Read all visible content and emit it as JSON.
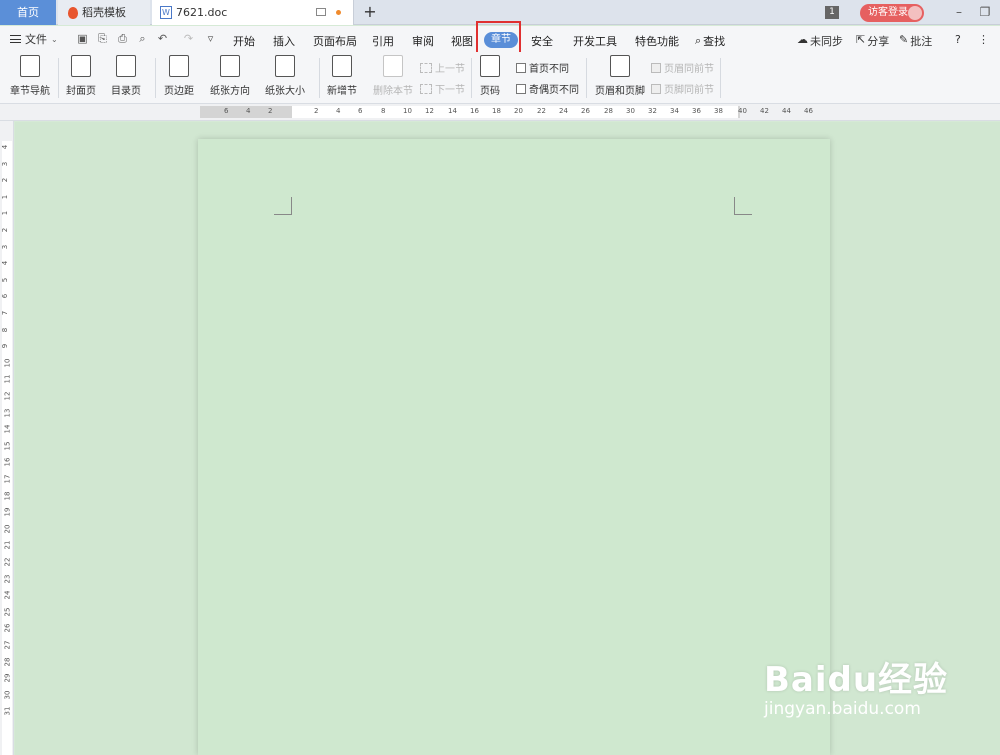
{
  "tabs": {
    "home": "首页",
    "template": "稻壳模板",
    "doc": "7621.doc",
    "doc_icon": "W",
    "new_tab": "+"
  },
  "titlebar": {
    "count": "1",
    "login": "访客登录"
  },
  "menu": {
    "file": "文件",
    "items": [
      "开始",
      "插入",
      "页面布局",
      "引用",
      "审阅",
      "视图"
    ],
    "active": "章节",
    "items_after": [
      "安全",
      "开发工具",
      "特色功能"
    ],
    "search": "查找",
    "sync": "未同步",
    "share": "分享",
    "comment": "批注",
    "help": "?"
  },
  "ribbon": {
    "section_nav": "章节导航",
    "cover": "封面页",
    "toc": "目录页",
    "margin": "页边距",
    "orientation": "纸张方向",
    "size": "纸张大小",
    "new_section": "新增节",
    "delete_section": "删除本节",
    "prev_section": "上一节",
    "next_section": "下一节",
    "page_num": "页码",
    "first_diff": "首页不同",
    "oddeven_diff": "奇偶页不同",
    "header_footer": "页眉和页脚",
    "header_same": "页眉同前节",
    "footer_same": "页脚同前节"
  },
  "ruler": {
    "h_labels": [
      "6",
      "4",
      "2",
      "2",
      "4",
      "6",
      "8",
      "10",
      "12",
      "14",
      "16",
      "18",
      "20",
      "22",
      "24",
      "26",
      "28",
      "30",
      "32",
      "34",
      "36",
      "38",
      "40",
      "42",
      "44",
      "46"
    ],
    "v_labels": [
      "4",
      "3",
      "2",
      "1",
      "1",
      "2",
      "3",
      "4",
      "5",
      "6",
      "7",
      "8",
      "9",
      "10",
      "11",
      "12",
      "13",
      "14",
      "15",
      "16",
      "17",
      "18",
      "19",
      "20",
      "21",
      "22",
      "23",
      "24",
      "25",
      "26",
      "27",
      "28",
      "29",
      "30",
      "31"
    ]
  },
  "watermark": {
    "brand": "Baidu经验",
    "url": "jingyan.baidu.com"
  },
  "colors": {
    "accent": "#5a8ed8",
    "page_bg": "#cfe8cf",
    "highlight": "#e03030",
    "login": "#e66060"
  }
}
